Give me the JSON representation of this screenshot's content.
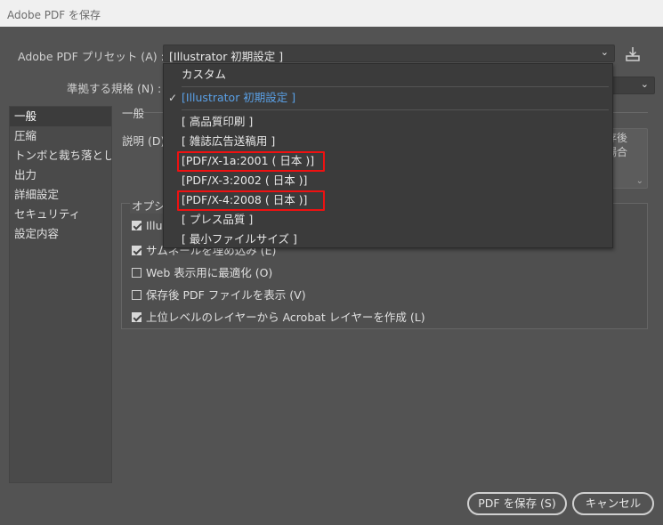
{
  "window": {
    "title": "Adobe PDF を保存"
  },
  "preset": {
    "label": "Adobe PDF プリセット (A) :",
    "value": "[Illustrator 初期設定 ]"
  },
  "standard": {
    "label": "準拠する規格 (N) :"
  },
  "sidebar": {
    "items": [
      {
        "label": "一般",
        "active": true
      },
      {
        "label": "圧縮"
      },
      {
        "label": "トンボと裁ち落とし"
      },
      {
        "label": "出力"
      },
      {
        "label": "詳細設定"
      },
      {
        "label": "セキュリティ"
      },
      {
        "label": "設定内容"
      }
    ]
  },
  "general": {
    "section_title": "一般",
    "description_label": "説明 (D)",
    "description_text_line1": "存後",
    "description_text_line2": "場合"
  },
  "options": {
    "legend": "オプシ",
    "items": [
      {
        "label": "Illu",
        "checked": true
      },
      {
        "label": "サムネールを埋め込み (E)",
        "checked": true
      },
      {
        "label": "Web 表示用に最適化 (O)",
        "checked": false
      },
      {
        "label": "保存後 PDF ファイルを表示 (V)",
        "checked": false
      },
      {
        "label": "上位レベルのレイヤーから Acrobat レイヤーを作成 (L)",
        "checked": true
      }
    ]
  },
  "preset_dropdown": {
    "items": [
      {
        "label": "カスタム"
      },
      {
        "label": "[Illustrator 初期設定 ]",
        "selected": true
      },
      {
        "label": "[ 高品質印刷 ]"
      },
      {
        "label": "[ 雑誌広告送稿用 ]"
      },
      {
        "label": "[PDF/X-1a:2001 ( 日本 )]",
        "highlighted": true
      },
      {
        "label": "[PDF/X-3:2002 ( 日本 )]"
      },
      {
        "label": "[PDF/X-4:2008 ( 日本 )]",
        "highlighted": true
      },
      {
        "label": "[ プレス品質 ]"
      },
      {
        "label": "[ 最小ファイルサイズ ]"
      }
    ]
  },
  "buttons": {
    "save": "PDF を保存 (S)",
    "cancel": "キャンセル"
  },
  "colors": {
    "background": "#535353",
    "selected_item": "#5aa0e6",
    "highlight_box": "#e11111"
  },
  "icons": {
    "save_preset": "save-preset-icon",
    "chevron": "chevron-down-icon",
    "check": "check-icon"
  }
}
